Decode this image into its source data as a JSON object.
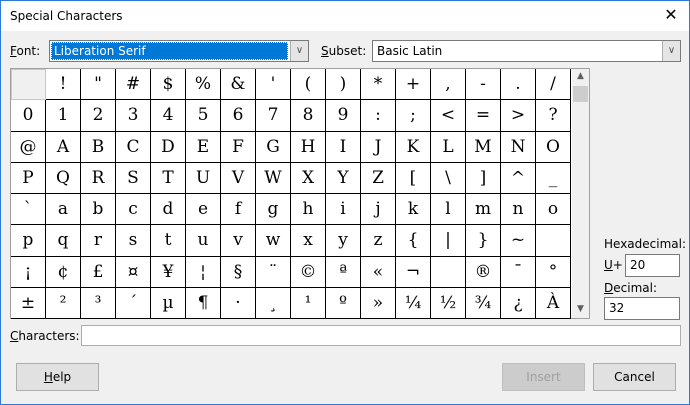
{
  "window": {
    "title": "Special Characters",
    "close_icon": "close-icon"
  },
  "font": {
    "label": "Font:",
    "value": "Liberation Serif"
  },
  "subset": {
    "label": "Subset:",
    "value": "Basic Latin"
  },
  "characters_grid": [
    " ",
    "!",
    "\"",
    "#",
    "$",
    "%",
    "&",
    "'",
    "(",
    ")",
    "*",
    "+",
    ",",
    "-",
    ".",
    "/",
    "0",
    "1",
    "2",
    "3",
    "4",
    "5",
    "6",
    "7",
    "8",
    "9",
    ":",
    ";",
    "<",
    "=",
    ">",
    "?",
    "@",
    "A",
    "B",
    "C",
    "D",
    "E",
    "F",
    "G",
    "H",
    "I",
    "J",
    "K",
    "L",
    "M",
    "N",
    "O",
    "P",
    "Q",
    "R",
    "S",
    "T",
    "U",
    "V",
    "W",
    "X",
    "Y",
    "Z",
    "[",
    "\\",
    "]",
    "^",
    "_",
    "`",
    "a",
    "b",
    "c",
    "d",
    "e",
    "f",
    "g",
    "h",
    "i",
    "j",
    "k",
    "l",
    "m",
    "n",
    "o",
    "p",
    "q",
    "r",
    "s",
    "t",
    "u",
    "v",
    "w",
    "x",
    "y",
    "z",
    "{",
    "|",
    "}",
    "~",
    " ",
    "¡",
    "¢",
    "£",
    "¤",
    "¥",
    "¦",
    "§",
    "¨",
    "©",
    "ª",
    "«",
    "¬",
    "­",
    "®",
    "¯",
    "°",
    "±",
    "²",
    "³",
    "´",
    "µ",
    "¶",
    "·",
    "¸",
    "¹",
    "º",
    "»",
    "¼",
    "½",
    "¾",
    "¿",
    "À"
  ],
  "selected_index": 0,
  "hex": {
    "label": "Hexadecimal:",
    "prefix": "U+",
    "value": "20"
  },
  "decimal": {
    "label": "Decimal:",
    "value": "32"
  },
  "characters": {
    "label": "Characters:",
    "value": ""
  },
  "buttons": {
    "help": "Help",
    "insert": "Insert",
    "cancel": "Cancel"
  }
}
